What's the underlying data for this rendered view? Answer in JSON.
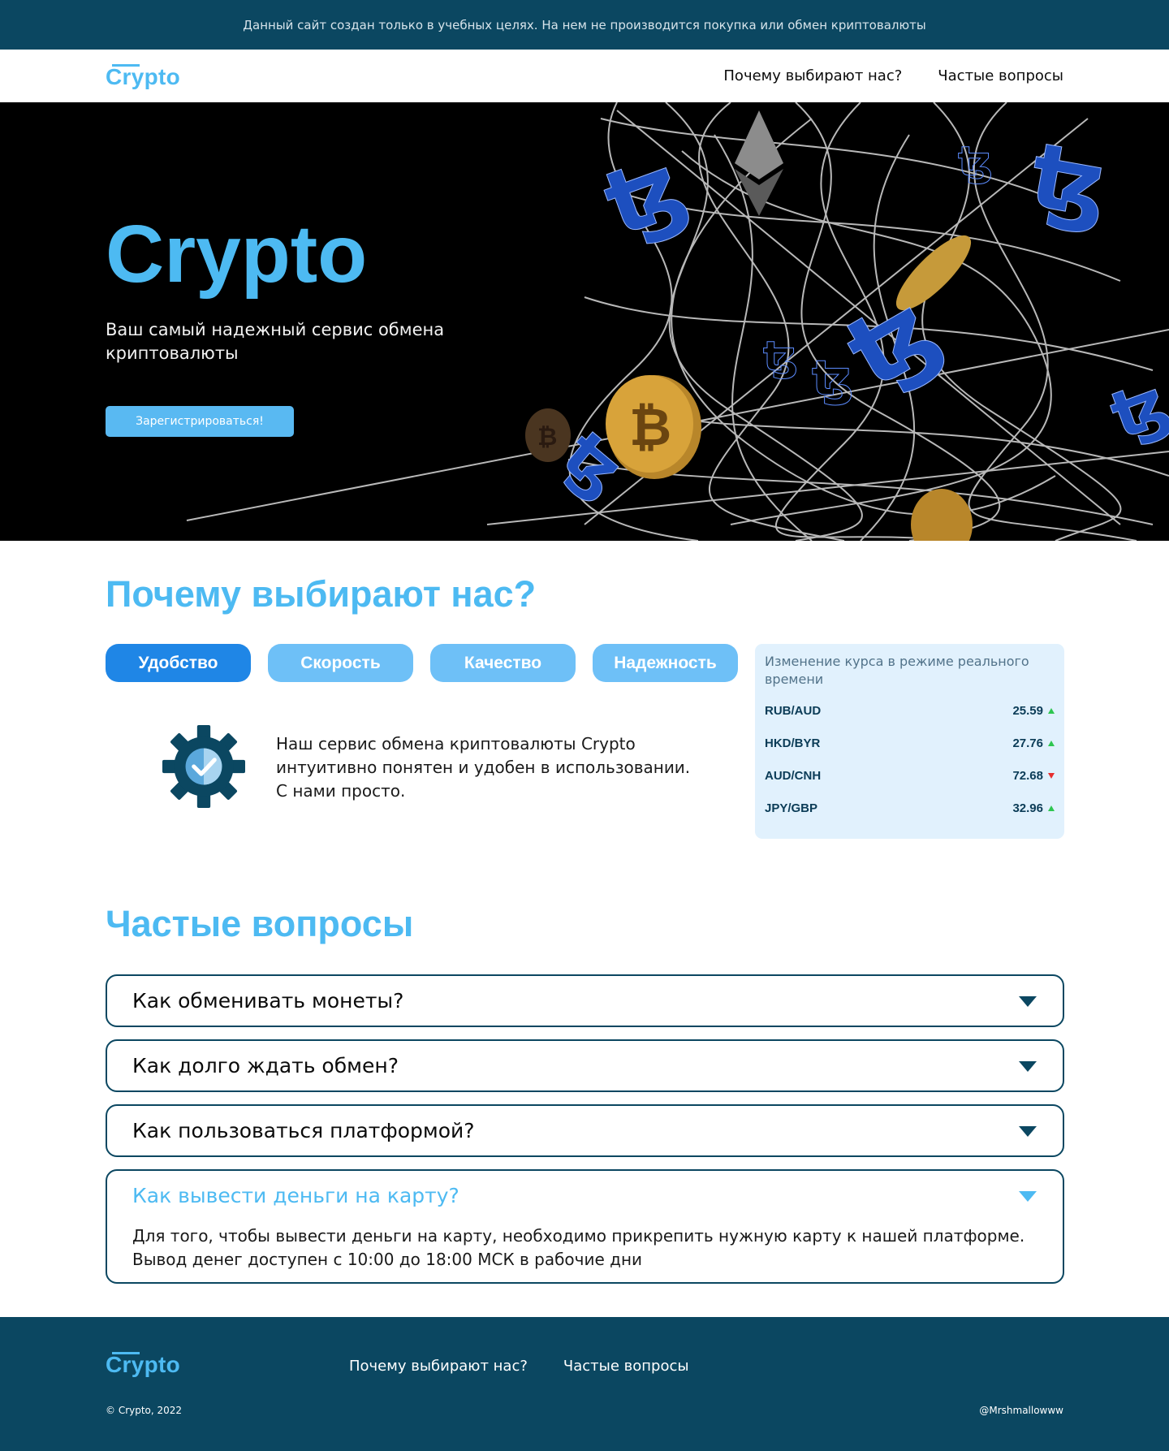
{
  "notice": "Данный сайт создан только в учебных целях. На нем не производится покупка или обмен криптовалюты",
  "nav": {
    "logo": "Crypto",
    "links": [
      "Почему выбирают нас?",
      "Частые вопросы"
    ]
  },
  "hero": {
    "title": "Crypto",
    "subtitle": "Ваш самый надежный сервис обмена криптовалюты",
    "button": "Зарегистрироваться!"
  },
  "why": {
    "title": "Почему выбирают нас?",
    "tabs": [
      "Удобство",
      "Скорость",
      "Качество",
      "Надежность"
    ],
    "active_tab": "Удобство",
    "feature_icon": "gear-check-icon",
    "feature_text": "Наш сервис обмена криптовалюты Crypto интуитивно понятен и удобен в использовании. С нами просто."
  },
  "rates": {
    "title": "Изменение курса в режиме реального времени",
    "rows": [
      {
        "pair": "RUB/AUD",
        "value": "25.59",
        "trend": "up"
      },
      {
        "pair": "HKD/BYR",
        "value": "27.76",
        "trend": "up"
      },
      {
        "pair": "AUD/CNH",
        "value": "72.68",
        "trend": "down"
      },
      {
        "pair": "JPY/GBP",
        "value": "32.96",
        "trend": "up"
      }
    ]
  },
  "faq": {
    "title": "Частые вопросы",
    "items": [
      {
        "question": "Как обменивать монеты?",
        "open": false
      },
      {
        "question": "Как долго ждать обмен?",
        "open": false
      },
      {
        "question": "Как пользоваться платформой?",
        "open": false
      },
      {
        "question": "Как вывести деньги на карту?",
        "open": true,
        "answer": "Для того, чтобы вывести деньги на карту, необходимо прикрепить нужную карту к нашей платформе. Вывод денег доступен с 10:00 до 18:00 МСК в рабочие дни"
      }
    ]
  },
  "footer": {
    "logo": "Crypto",
    "links": [
      "Почему выбирают нас?",
      "Частые вопросы"
    ],
    "copyright": "© Crypto, 2022",
    "author": "@Mrshmallowww"
  },
  "colors": {
    "accent": "#4dbaf2",
    "dark_teal": "#0b4761",
    "active_tab": "#1f86e6",
    "tab": "#6ec0f7",
    "rates_bg": "#e1f1fd",
    "trend_up": "#2ec650",
    "trend_down": "#e62e2e"
  }
}
